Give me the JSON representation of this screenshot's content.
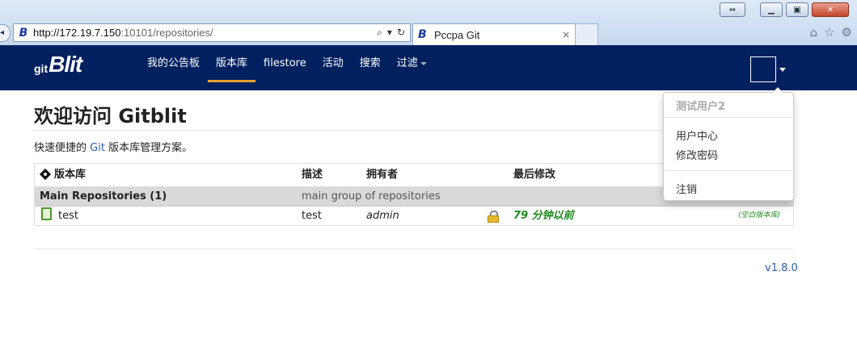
{
  "browser": {
    "url_host": "http://172.19.7.150",
    "url_rest": ":10101/repositories/",
    "tab_title": "Pccpa Git",
    "tab_close": "×",
    "favicon_letter": "B"
  },
  "navbar": {
    "brand_prefix": "git",
    "brand_main": "Blit",
    "items": [
      {
        "label": "我的公告板"
      },
      {
        "label": "版本库"
      },
      {
        "label": "filestore"
      },
      {
        "label": "活动"
      },
      {
        "label": "搜索"
      },
      {
        "label": "过滤"
      }
    ],
    "active_item": "版本库"
  },
  "page": {
    "title": "欢迎访问 Gitblit",
    "subtitle_pre": "快速便捷的 ",
    "subtitle_link": "Git",
    "subtitle_post": " 版本库管理方案。"
  },
  "table": {
    "headers": {
      "repository": "版本库",
      "description": "描述",
      "owner": "拥有者",
      "last_change": "最后修改"
    },
    "group": {
      "name": "Main Repositories (1)",
      "description": "main group of repositories"
    },
    "rows": [
      {
        "name": "test",
        "description": "test",
        "owner": "admin",
        "last_change": "79 分钟以前",
        "badge": "(空白版本库)"
      }
    ]
  },
  "footer": {
    "version": "v1.8.0"
  },
  "user_menu": {
    "username": "测试用户2",
    "items": [
      "用户中心",
      "修改密码",
      "注销"
    ]
  }
}
